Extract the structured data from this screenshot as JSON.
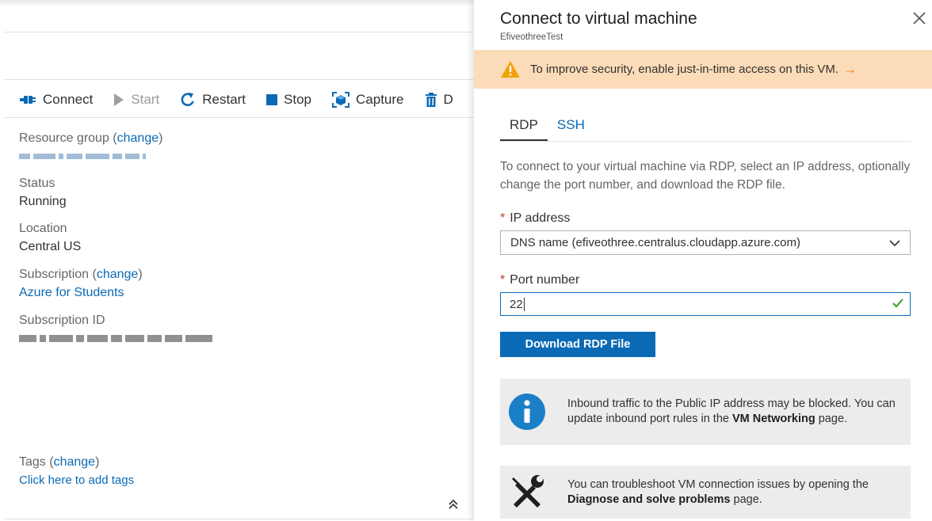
{
  "toolbar": {
    "connect": "Connect",
    "start": "Start",
    "restart": "Restart",
    "stop": "Stop",
    "capture": "Capture",
    "delete_partial": "D"
  },
  "essentials": {
    "resource_group_label": "Resource group (",
    "resource_group_change": "change",
    "resource_group_close": ")",
    "status_label": "Status",
    "status_value": "Running",
    "location_label": "Location",
    "location_value": "Central US",
    "subscription_label": "Subscription (",
    "subscription_change": "change",
    "subscription_close": ")",
    "subscription_value": "Azure for Students",
    "subscription_id_label": "Subscription ID",
    "tags_label": "Tags (",
    "tags_change": "change",
    "tags_close": ")",
    "tags_add": "Click here to add tags",
    "collapse_glyph": "≈"
  },
  "connect_panel": {
    "title": "Connect to virtual machine",
    "subtitle": "EfiveothreeTest",
    "warning_text": "To improve security, enable just-in-time access on this VM.",
    "warning_arrow": "→",
    "tabs": [
      {
        "label": "RDP",
        "active": true
      },
      {
        "label": "SSH",
        "active": false
      }
    ],
    "description": "To connect to your virtual machine via RDP, select an IP address, optionally change the port number, and download the RDP file.",
    "ip_label": "IP address",
    "ip_value": "DNS name (efiveothree.centralus.cloudapp.azure.com)",
    "port_label": "Port number",
    "port_value": "22",
    "required_mark": "*",
    "download_button": "Download RDP File",
    "info1_pre": "Inbound traffic to the Public IP address may be blocked. You can update inbound port rules in the ",
    "info1_bold": "VM Networking",
    "info1_post": " page.",
    "info2_pre": "You can troubleshoot VM connection issues by opening the ",
    "info2_bold": "Diagnose and solve problems",
    "info2_post": " page."
  },
  "colors": {
    "accent": "#0b6ab5",
    "warning_bg": "#fcdcb8",
    "warning_icon": "#f0a30a",
    "valid_check": "#3a9a2d",
    "required": "#c0392b",
    "info_bg": "#ececec"
  },
  "icons": {
    "connect": "plug-icon",
    "start": "play-icon",
    "restart": "restart-icon",
    "stop": "stop-icon",
    "capture": "capture-icon",
    "delete": "trash-icon",
    "close": "close-icon",
    "warning": "warning-icon",
    "dropdown": "chevron-down-icon",
    "valid": "checkmark-icon",
    "info": "info-icon",
    "tools": "tools-icon"
  }
}
